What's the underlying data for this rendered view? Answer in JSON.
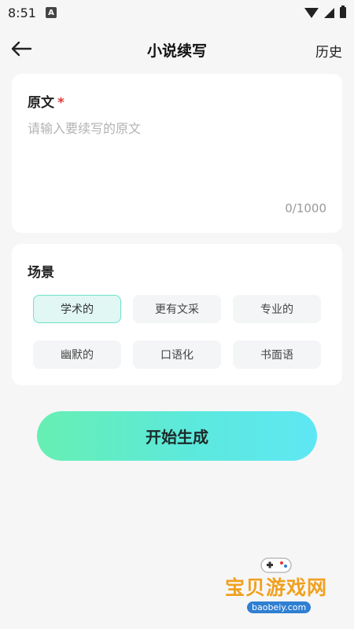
{
  "status_bar": {
    "time": "8:51",
    "app_icon_letter": "A"
  },
  "header": {
    "title": "小说续写",
    "history_label": "历史"
  },
  "source": {
    "label": "原文",
    "required": "*",
    "placeholder": "请输入要续写的原文",
    "value": "",
    "char_count": "0/1000"
  },
  "scene": {
    "label": "场景",
    "options": [
      {
        "label": "学术的",
        "selected": true
      },
      {
        "label": "更有文采",
        "selected": false
      },
      {
        "label": "专业的",
        "selected": false
      },
      {
        "label": "幽默的",
        "selected": false
      },
      {
        "label": "口语化",
        "selected": false
      },
      {
        "label": "书面语",
        "selected": false
      }
    ]
  },
  "start_button_label": "开始生成",
  "watermark": {
    "text": "宝贝游戏网",
    "url": "baobeiy.com"
  },
  "colors": {
    "accent_start": "#67efb2",
    "accent_end": "#5ee7f4",
    "required": "#e03a3a"
  }
}
